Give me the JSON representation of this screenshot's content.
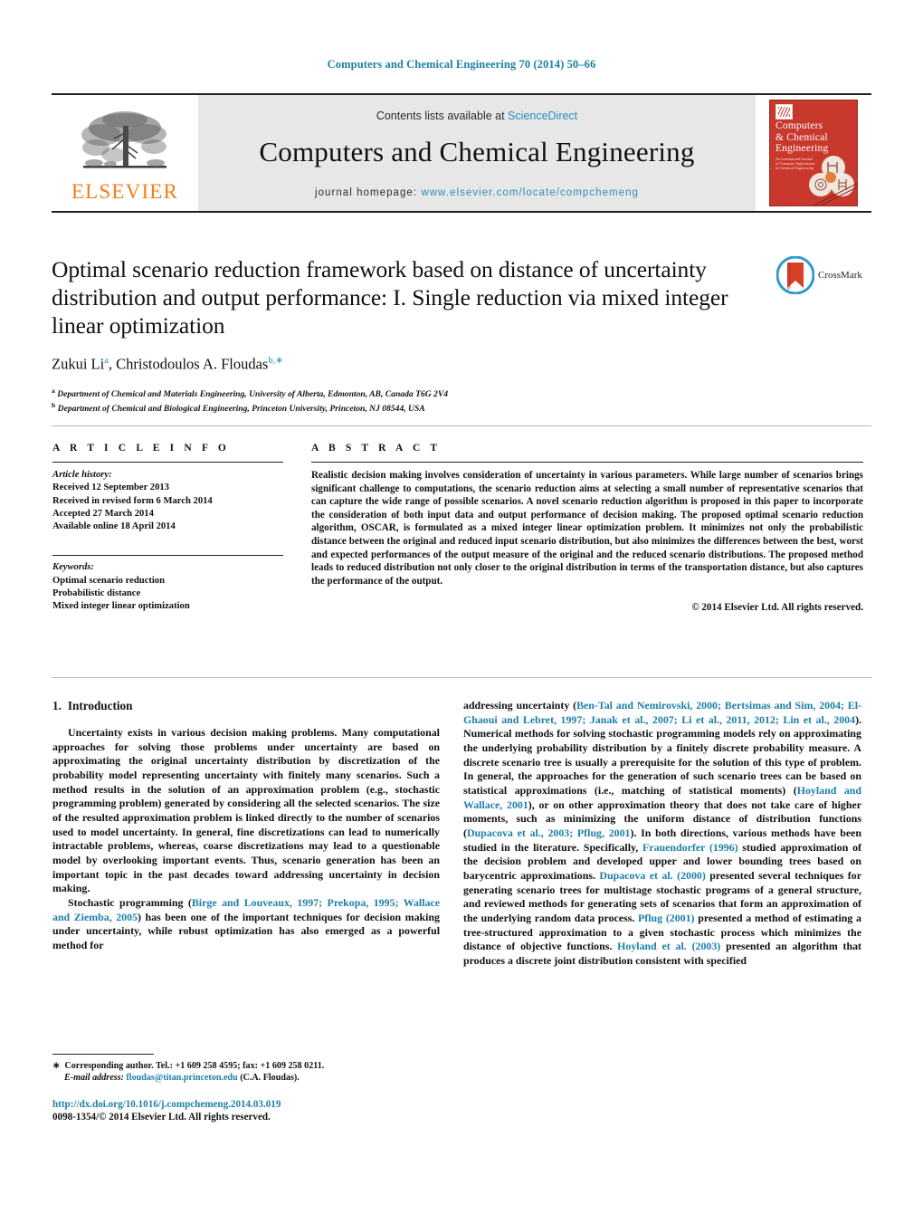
{
  "running_head": "Computers and Chemical Engineering 70 (2014) 50–66",
  "masthead": {
    "publisher_name": "ELSEVIER",
    "contents_prefix": "Contents lists available at ",
    "contents_link": "ScienceDirect",
    "journal_title": "Computers and Chemical Engineering",
    "homepage_prefix": "journal homepage: ",
    "homepage_url": "www.elsevier.com/locate/compchemeng",
    "cover": {
      "line1": "Computers",
      "line2": "& Chemical",
      "line3": "Engineering",
      "subtitle": "An International Journal of Computer Applications in Chemical Engineering"
    }
  },
  "article": {
    "title": "Optimal scenario reduction framework based on distance of uncertainty distribution and output performance: I. Single reduction via mixed integer linear optimization",
    "authors_html": "Zukui Li<sup>a</sup>, Christodoulos A. Floudas<sup>b,∗</sup>",
    "affiliation_a_marker": "a",
    "affiliation_a": "Department of Chemical and Materials Engineering, University of Alberta, Edmonton, AB, Canada T6G 2V4",
    "affiliation_b_marker": "b",
    "affiliation_b": "Department of Chemical and Biological Engineering, Princeton University, Princeton, NJ 08544, USA",
    "crossmark_label": "CrossMark"
  },
  "info": {
    "heading": "A R T I C L E    I N F O",
    "history_label": "Article history:",
    "history": [
      "Received 12 September 2013",
      "Received in revised form 6 March 2014",
      "Accepted 27 March 2014",
      "Available online 18 April 2014"
    ],
    "keywords_label": "Keywords:",
    "keywords": [
      "Optimal scenario reduction",
      "Probabilistic distance",
      "Mixed integer linear optimization"
    ]
  },
  "abstract": {
    "heading": "A B S T R A C T",
    "text": "Realistic decision making involves consideration of uncertainty in various parameters. While large number of scenarios brings significant challenge to computations, the scenario reduction aims at selecting a small number of representative scenarios that can capture the wide range of possible scenarios. A novel scenario reduction algorithm is proposed in this paper to incorporate the consideration of both input data and output performance of decision making. The proposed optimal scenario reduction algorithm, OSCAR, is formulated as a mixed integer linear optimization problem. It minimizes not only the probabilistic distance between the original and reduced input scenario distribution, but also minimizes the differences between the best, worst and expected performances of the output measure of the original and the reduced scenario distributions. The proposed method leads to reduced distribution not only closer to the original distribution in terms of the transportation distance, but also captures the performance of the output.",
    "copyright": "© 2014 Elsevier Ltd. All rights reserved."
  },
  "body": {
    "section_number": "1.",
    "section_title": "Introduction",
    "left_para_1": "Uncertainty exists in various decision making problems. Many computational approaches for solving those problems under uncertainty are based on approximating the original uncertainty distribution by discretization of the probability model representing uncertainty with finitely many scenarios. Such a method results in the solution of an approximation problem (e.g., stochastic programming problem) generated by considering all the selected scenarios. The size of the resulted approximation problem is linked directly to the number of scenarios used to model uncertainty. In general, fine discretizations can lead to numerically intractable problems, whereas, coarse discretizations may lead to a questionable model by overlooking important events. Thus, scenario generation has been an important topic in the past decades toward addressing uncertainty in decision making.",
    "left_para_2_a": "Stochastic programming (",
    "left_para_2_cite": "Birge and Louveaux, 1997; Prekopa, 1995; Wallace and Ziemba, 2005",
    "left_para_2_b": ") has been one of the important techniques for decision making under uncertainty, while robust optimization has also emerged as a powerful method for",
    "right_seg_1": "addressing uncertainty (",
    "right_cite_1": "Ben-Tal and Nemirovski, 2000; Bertsimas and Sim, 2004; El-Ghaoui and Lebret, 1997; Janak et al., 2007; Li et al., 2011, 2012; Lin et al., 2004",
    "right_seg_2": "). Numerical methods for solving stochastic programming models rely on approximating the underlying probability distribution by a finitely discrete probability measure. A discrete scenario tree is usually a prerequisite for the solution of this type of problem. In general, the approaches for the generation of such scenario trees can be based on statistical approximations (i.e., matching of statistical moments) (",
    "right_cite_2": "Hoyland and Wallace, 2001",
    "right_seg_3": "), or on other approximation theory that does not take care of higher moments, such as minimizing the uniform distance of distribution functions (",
    "right_cite_3": "Dupacova et al., 2003; Pflug, 2001",
    "right_seg_4": "). In both directions, various methods have been studied in the literature. Specifically, ",
    "right_cite_4": "Frauendorfer (1996)",
    "right_seg_5": " studied approximation of the decision problem and developed upper and lower bounding trees based on barycentric approximations. ",
    "right_cite_5": "Dupacova et al. (2000)",
    "right_seg_6": " presented several techniques for generating scenario trees for multistage stochastic programs of a general structure, and reviewed methods for generating sets of scenarios that form an approximation of the underlying random data process. ",
    "right_cite_6": "Pflug (2001)",
    "right_seg_7": " presented a method of estimating a tree-structured approximation to a given stochastic process which minimizes the distance of objective functions. ",
    "right_cite_7": "Hoyland et al. (2003)",
    "right_seg_8": " presented an algorithm that produces a discrete joint distribution consistent with specified"
  },
  "footer": {
    "corresponding_star": "∗",
    "corresponding_text": "Corresponding author. Tel.: +1 609 258 4595; fax: +1 609 258 0211.",
    "email_label": "E-mail address:",
    "email": "floudas@titan.princeton.edu",
    "email_suffix": " (C.A. Floudas).",
    "doi": "http://dx.doi.org/10.1016/j.compchemeng.2014.03.019",
    "issn": "0098-1354/© 2014 Elsevier Ltd. All rights reserved."
  },
  "colors": {
    "link": "#1b7fa8",
    "sciencedirect": "#2b8cbe",
    "elsevier_orange": "#f07f1a",
    "cover_red": "#c8382c",
    "masthead_grey": "#e7e7e8"
  }
}
